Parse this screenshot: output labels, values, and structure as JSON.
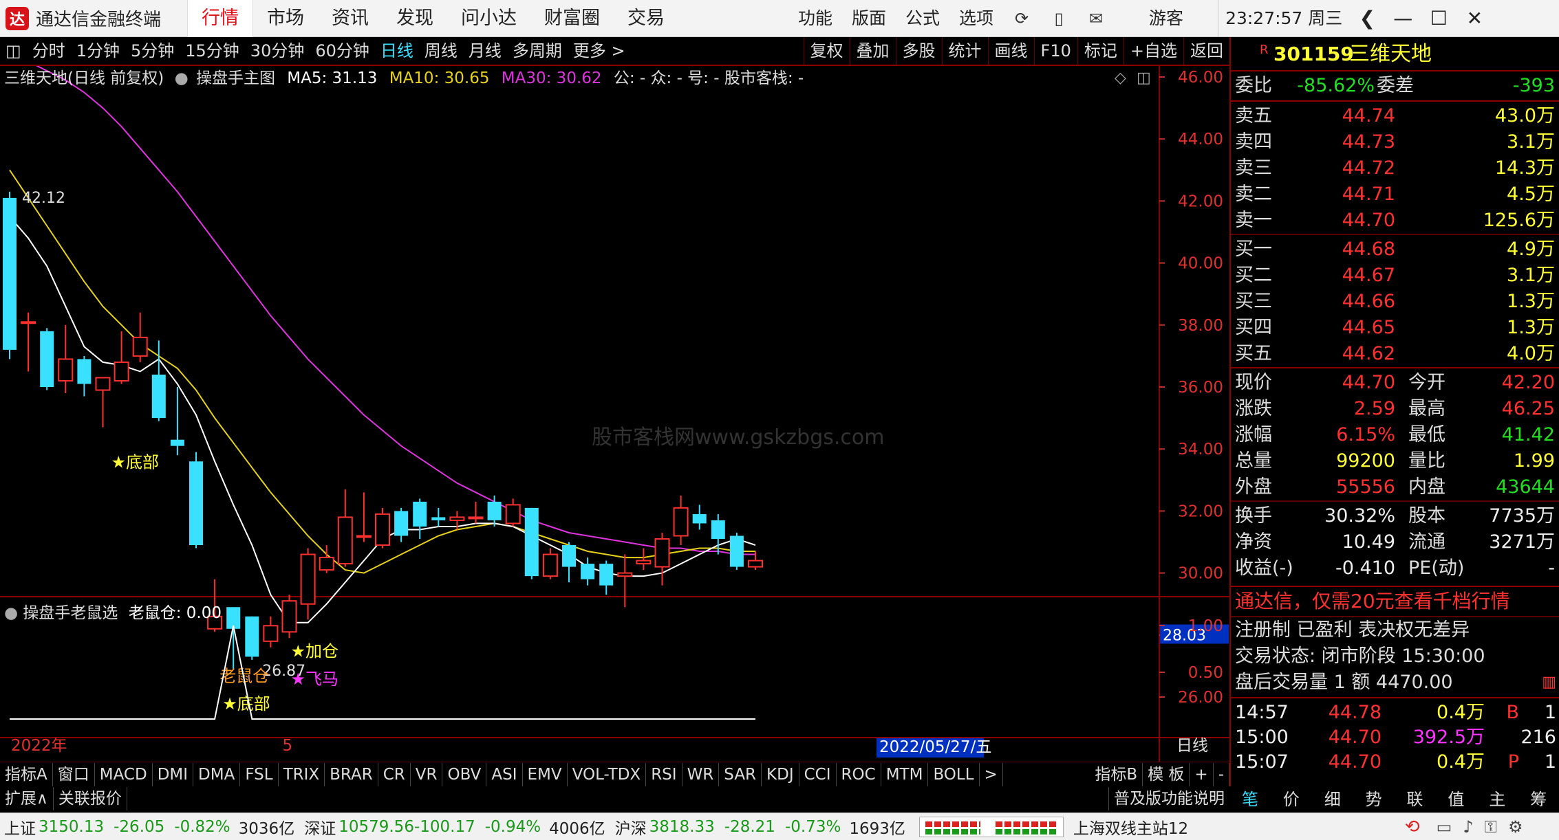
{
  "app": {
    "logo_char": "达",
    "name": "通达信金融终端",
    "tabs": [
      "行情",
      "市场",
      "资讯",
      "发现",
      "问小达",
      "财富圈",
      "交易"
    ],
    "active_tab": 0,
    "menus": [
      "功能",
      "版面",
      "公式",
      "选项"
    ],
    "user": "游客",
    "clock": "23:27:57 周三"
  },
  "toolbar": {
    "left": [
      "分时",
      "1分钟",
      "5分钟",
      "15分钟",
      "30分钟",
      "60分钟",
      "日线",
      "周线",
      "月线",
      "多周期",
      "更多 >"
    ],
    "selected": "日线",
    "right": [
      "复权",
      "叠加",
      "多股",
      "统计",
      "画线",
      "F10",
      "标记",
      "+自选",
      "返回"
    ]
  },
  "chart": {
    "title": "三维天地(日线 前复权)",
    "indicator": "操盘手主图",
    "ma5_label": "MA5: 31.13",
    "ma10_label": "MA10: 30.65",
    "ma30_label": "MA30: 30.62",
    "extra_label": "公: - 众: - 号: - 股市客栈: -",
    "y_ticks": [
      "46.00",
      "44.00",
      "42.00",
      "40.00",
      "38.00",
      "36.00",
      "34.00",
      "32.00",
      "30.00",
      "28.00",
      "26.00"
    ],
    "last_price_tag": "28.03",
    "high_label": "42.12",
    "low_label": "26.87",
    "signals": {
      "bottom1": "★底部",
      "bottom2": "★底部",
      "laoshu": "老鼠仓",
      "jiacang": "★加仓",
      "feima": "★飞马"
    },
    "watermark": "股市客栈网www.gskzbgs.com",
    "x_labels": [
      "2022年",
      "5",
      "2022/05/27/五"
    ],
    "period_label": "日线",
    "colors": {
      "up": "#ff3030",
      "down": "#39e0ff",
      "ma5": "#ffffff",
      "ma10": "#e6d21a",
      "ma30": "#e033e0"
    }
  },
  "chart_data": {
    "type": "candlestick",
    "title": "三维天地(日线 前复权)",
    "ylim": [
      25,
      47
    ],
    "candles": [
      {
        "o": 42.1,
        "h": 42.3,
        "c": 37.2,
        "l": 36.9
      },
      {
        "o": 38.1,
        "h": 38.4,
        "c": 38.1,
        "l": 36.5
      },
      {
        "o": 37.8,
        "h": 37.9,
        "c": 36.0,
        "l": 35.9
      },
      {
        "o": 36.2,
        "h": 38.0,
        "c": 36.9,
        "l": 35.8
      },
      {
        "o": 36.9,
        "h": 37.0,
        "c": 36.1,
        "l": 35.7
      },
      {
        "o": 35.9,
        "h": 36.2,
        "c": 36.3,
        "l": 34.7
      },
      {
        "o": 36.2,
        "h": 37.8,
        "c": 36.8,
        "l": 36.1
      },
      {
        "o": 37.0,
        "h": 38.4,
        "c": 37.6,
        "l": 36.8
      },
      {
        "o": 36.4,
        "h": 37.5,
        "c": 35.0,
        "l": 34.9
      },
      {
        "o": 34.3,
        "h": 36.0,
        "c": 34.1,
        "l": 33.8
      },
      {
        "o": 33.6,
        "h": 33.9,
        "c": 30.9,
        "l": 30.8
      },
      {
        "o": 28.2,
        "h": 29.8,
        "c": 28.6,
        "l": 28.1
      },
      {
        "o": 28.9,
        "h": 28.6,
        "c": 28.2,
        "l": 26.9
      },
      {
        "o": 28.6,
        "h": 28.6,
        "c": 27.3,
        "l": 27.2
      },
      {
        "o": 27.8,
        "h": 28.6,
        "c": 28.3,
        "l": 27.6
      },
      {
        "o": 28.1,
        "h": 29.3,
        "c": 29.1,
        "l": 27.9
      },
      {
        "o": 29.0,
        "h": 30.8,
        "c": 30.6,
        "l": 28.5
      },
      {
        "o": 30.1,
        "h": 30.9,
        "c": 30.5,
        "l": 30.0
      },
      {
        "o": 30.3,
        "h": 32.7,
        "c": 31.8,
        "l": 30.2
      },
      {
        "o": 31.2,
        "h": 32.6,
        "c": 31.2,
        "l": 31.0
      },
      {
        "o": 30.9,
        "h": 32.1,
        "c": 31.9,
        "l": 30.8
      },
      {
        "o": 32.0,
        "h": 32.1,
        "c": 31.2,
        "l": 31.0
      },
      {
        "o": 32.3,
        "h": 32.4,
        "c": 31.5,
        "l": 31.1
      },
      {
        "o": 31.8,
        "h": 32.1,
        "c": 31.7,
        "l": 31.5
      },
      {
        "o": 31.7,
        "h": 32.0,
        "c": 31.8,
        "l": 31.4
      },
      {
        "o": 31.8,
        "h": 32.3,
        "c": 31.8,
        "l": 31.6
      },
      {
        "o": 32.3,
        "h": 32.5,
        "c": 31.7,
        "l": 31.5
      },
      {
        "o": 31.6,
        "h": 32.4,
        "c": 32.2,
        "l": 31.5
      },
      {
        "o": 32.1,
        "h": 32.1,
        "c": 29.9,
        "l": 29.8
      },
      {
        "o": 29.9,
        "h": 30.8,
        "c": 30.6,
        "l": 29.8
      },
      {
        "o": 30.9,
        "h": 31.0,
        "c": 30.2,
        "l": 29.7
      },
      {
        "o": 30.3,
        "h": 30.5,
        "c": 29.8,
        "l": 29.6
      },
      {
        "o": 30.3,
        "h": 30.4,
        "c": 29.6,
        "l": 29.3
      },
      {
        "o": 29.9,
        "h": 30.6,
        "c": 30.0,
        "l": 28.9
      },
      {
        "o": 30.3,
        "h": 30.8,
        "c": 30.4,
        "l": 30.1
      },
      {
        "o": 30.2,
        "h": 31.3,
        "c": 31.1,
        "l": 29.6
      },
      {
        "o": 31.2,
        "h": 32.5,
        "c": 32.1,
        "l": 30.9
      },
      {
        "o": 31.9,
        "h": 32.2,
        "c": 31.6,
        "l": 31.4
      },
      {
        "o": 31.7,
        "h": 31.9,
        "c": 31.1,
        "l": 30.6
      },
      {
        "o": 31.2,
        "h": 31.3,
        "c": 30.2,
        "l": 30.1
      },
      {
        "o": 30.2,
        "h": 30.7,
        "c": 30.4,
        "l": 30.1
      }
    ],
    "ma5": [
      41.5,
      40.8,
      39.9,
      38.6,
      37.3,
      36.8,
      36.7,
      36.5,
      36.9,
      36.1,
      35.1,
      33.6,
      32.2,
      30.9,
      29.3,
      28.4,
      28.4,
      29.0,
      29.7,
      30.4,
      31.1,
      31.4,
      31.4,
      31.5,
      31.5,
      31.6,
      31.6,
      31.5,
      31.2,
      30.9,
      30.6,
      30.2,
      30.0,
      29.9,
      29.9,
      30.0,
      30.3,
      30.6,
      30.9,
      31.1,
      30.9
    ],
    "ma10": [
      43.0,
      42.1,
      41.2,
      40.3,
      39.4,
      38.6,
      38.0,
      37.4,
      37.0,
      36.6,
      35.9,
      35.0,
      34.2,
      33.4,
      32.6,
      31.9,
      31.2,
      30.6,
      30.1,
      30.0,
      30.3,
      30.6,
      30.9,
      31.2,
      31.4,
      31.5,
      31.6,
      31.5,
      31.3,
      31.1,
      30.9,
      30.7,
      30.6,
      30.5,
      30.5,
      30.6,
      30.7,
      30.8,
      30.8,
      30.7,
      30.7
    ],
    "ma30": [
      46.7,
      46.5,
      46.2,
      45.9,
      45.5,
      45.0,
      44.4,
      43.7,
      43.0,
      42.3,
      41.5,
      40.7,
      39.9,
      39.1,
      38.3,
      37.6,
      36.9,
      36.3,
      35.7,
      35.1,
      34.6,
      34.1,
      33.7,
      33.3,
      32.9,
      32.6,
      32.3,
      32.0,
      31.7,
      31.5,
      31.3,
      31.2,
      31.1,
      31.0,
      30.9,
      30.8,
      30.8,
      30.7,
      30.7,
      30.6,
      30.6
    ]
  },
  "subchart": {
    "title": "操盘手老鼠选",
    "value_label": "老鼠仓: 0.00",
    "y_ticks": [
      "1.00",
      "0.50"
    ],
    "spike_index": 12,
    "spike_value": 1.0
  },
  "quote": {
    "code": "301159",
    "name": "三维天地",
    "badge": "R",
    "weibi_label": "委比",
    "weibi": "-85.62%",
    "weicha_label": "委差",
    "weicha": "-393",
    "sells": [
      {
        "label": "卖五",
        "price": "44.74",
        "vol": "43.0万"
      },
      {
        "label": "卖四",
        "price": "44.73",
        "vol": "3.1万"
      },
      {
        "label": "卖三",
        "price": "44.72",
        "vol": "14.3万"
      },
      {
        "label": "卖二",
        "price": "44.71",
        "vol": "4.5万"
      },
      {
        "label": "卖一",
        "price": "44.70",
        "vol": "125.6万"
      }
    ],
    "buys": [
      {
        "label": "买一",
        "price": "44.68",
        "vol": "4.9万"
      },
      {
        "label": "买二",
        "price": "44.67",
        "vol": "3.1万"
      },
      {
        "label": "买三",
        "price": "44.66",
        "vol": "1.3万"
      },
      {
        "label": "买四",
        "price": "44.65",
        "vol": "1.3万"
      },
      {
        "label": "买五",
        "price": "44.62",
        "vol": "4.0万"
      }
    ],
    "stats": [
      {
        "l1": "现价",
        "v1": "44.70",
        "c1": "red",
        "l2": "今开",
        "v2": "42.20",
        "c2": "red"
      },
      {
        "l1": "涨跌",
        "v1": "2.59",
        "c1": "red",
        "l2": "最高",
        "v2": "46.25",
        "c2": "red"
      },
      {
        "l1": "涨幅",
        "v1": "6.15%",
        "c1": "red",
        "l2": "最低",
        "v2": "41.42",
        "c2": "green"
      },
      {
        "l1": "总量",
        "v1": "99200",
        "c1": "yellow",
        "l2": "量比",
        "v2": "1.99",
        "c2": "yellow"
      },
      {
        "l1": "外盘",
        "v1": "55556",
        "c1": "red",
        "l2": "内盘",
        "v2": "43644",
        "c2": "green"
      }
    ],
    "fund": [
      {
        "l1": "换手",
        "v1": "30.32%",
        "l2": "股本",
        "v2": "7735万"
      },
      {
        "l1": "净资",
        "v1": "10.49",
        "l2": "流通",
        "v2": "3271万"
      },
      {
        "l1": "收益(-)",
        "v1": "-0.410",
        "l2": "PE(动)",
        "v2": "-"
      }
    ],
    "ad": "通达信，仅需20元查看千档行情",
    "info1": "注册制 已盈利 表决权无差异",
    "info2": "交易状态: 闭市阶段 15:30:00",
    "info3": "盘后交易量 1 额 4470.00",
    "ticks": [
      {
        "time": "14:57",
        "price": "44.78",
        "vol": "0.4万",
        "flag": "B",
        "n": "1"
      },
      {
        "time": "15:00",
        "price": "44.70",
        "vol": "392.5万",
        "flag": "",
        "n": "216"
      },
      {
        "time": "15:07",
        "price": "44.70",
        "vol": "0.4万",
        "flag": "P",
        "n": "1"
      }
    ],
    "tabs": [
      "笔",
      "价",
      "细",
      "势",
      "联",
      "值",
      "主",
      "筹"
    ]
  },
  "indicators": [
    "指标A",
    "窗口",
    "MACD",
    "DMI",
    "DMA",
    "FSL",
    "TRIX",
    "BRAR",
    "CR",
    "VR",
    "OBV",
    "ASI",
    "EMV",
    "VOL-TDX",
    "RSI",
    "WR",
    "SAR",
    "KDJ",
    "CCI",
    "ROC",
    "MTM",
    "BOLL",
    ">",
    "指标B",
    "模 板",
    "+",
    "-"
  ],
  "extbar": {
    "left1": "扩展∧",
    "left2": "关联报价",
    "right": "普及版功能说明"
  },
  "status": {
    "sh_label": "上证",
    "sh_val": "3150.13",
    "sh_chg": "-26.05",
    "sh_pct": "-0.82%",
    "sh_amt": "3036亿",
    "sz_label": "深证",
    "sz_val": "10579.56",
    "sz_chg": "-100.17",
    "sz_pct": "-0.94%",
    "sz_amt": "4006亿",
    "hs_label": "沪深",
    "hs_val": "3818.33",
    "hs_chg": "-28.21",
    "hs_pct": "-0.73%",
    "hs_amt": "1693亿",
    "server": "上海双线主站12"
  }
}
